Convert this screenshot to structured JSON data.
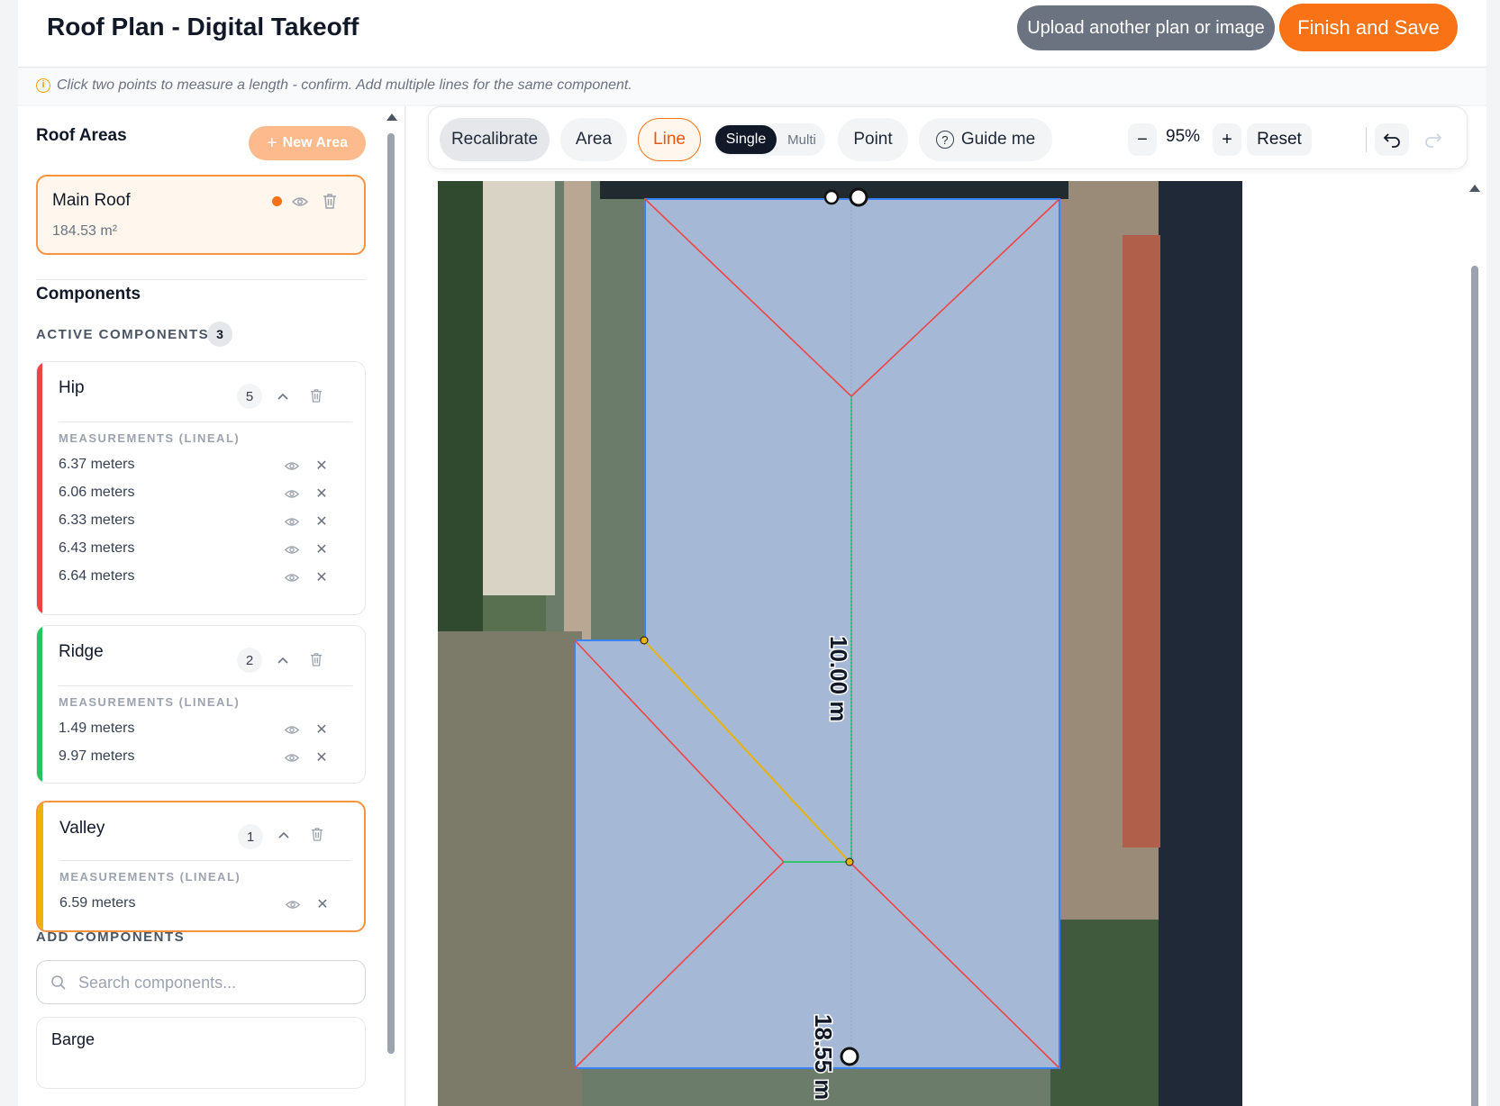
{
  "header": {
    "title": "Roof Plan - Digital Takeoff",
    "upload_label": "Upload another plan or image",
    "finish_label": "Finish and Save"
  },
  "hint": {
    "text": "Click two points to measure a length - confirm. Add multiple lines for the same component."
  },
  "roof_areas": {
    "title": "Roof Areas",
    "new_area_label": "New Area",
    "items": [
      {
        "name": "Main Roof",
        "size": "184.53 m²",
        "status_color": "#f97316"
      }
    ]
  },
  "components": {
    "title": "Components",
    "active_label": "ACTIVE COMPONENTS",
    "active_count": "3",
    "measurements_label": "MEASUREMENTS (LINEAL)",
    "items": [
      {
        "name": "Hip",
        "count": "5",
        "color": "#ef4444",
        "measurements": [
          "6.37 meters",
          "6.06 meters",
          "6.33 meters",
          "6.43 meters",
          "6.64 meters"
        ]
      },
      {
        "name": "Ridge",
        "count": "2",
        "color": "#22c55e",
        "measurements": [
          "1.49 meters",
          "9.97 meters"
        ]
      },
      {
        "name": "Valley",
        "count": "1",
        "color": "#eab308",
        "measurements": [
          "6.59 meters"
        ]
      }
    ],
    "add_label": "ADD COMPONENTS",
    "search_placeholder": "Search components...",
    "next_item": "Barge"
  },
  "toolbar": {
    "recalibrate": "Recalibrate",
    "area": "Area",
    "line": "Line",
    "single": "Single",
    "multi": "Multi",
    "point": "Point",
    "guide": "Guide me",
    "zoom": "95%",
    "reset": "Reset",
    "active_tool": "Line",
    "line_mode": "Single"
  },
  "plan": {
    "label_vertical": "10.00 m",
    "label_bottom": "18.55 m",
    "colors": {
      "hip": "#ef4444",
      "ridge": "#22c55e",
      "valley": "#eab308",
      "outline": "#3b82f6",
      "roof_fill": "#a5b8d6"
    }
  }
}
